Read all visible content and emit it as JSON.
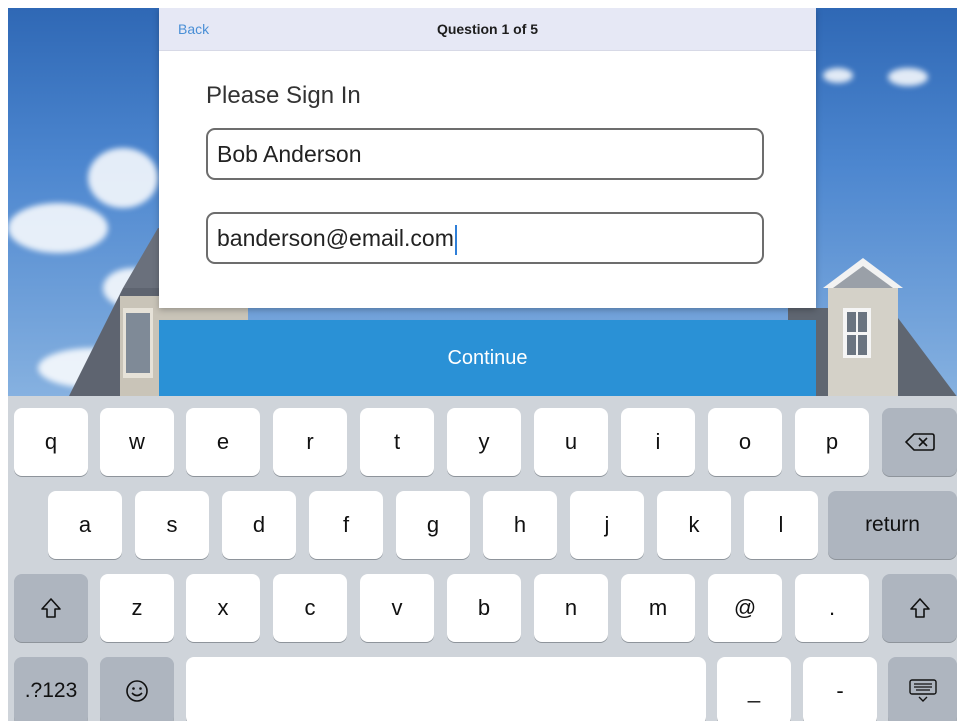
{
  "header": {
    "back_label": "Back",
    "title": "Question 1 of 5"
  },
  "form": {
    "prompt": "Please Sign In",
    "name_value": "Bob Anderson",
    "email_value": "banderson@email.com"
  },
  "continue_label": "Continue",
  "keyboard": {
    "row1": [
      "q",
      "w",
      "e",
      "r",
      "t",
      "y",
      "u",
      "i",
      "o",
      "p"
    ],
    "row2": [
      "a",
      "s",
      "d",
      "f",
      "g",
      "h",
      "j",
      "k",
      "l"
    ],
    "row3": [
      "z",
      "x",
      "c",
      "v",
      "b",
      "n",
      "m",
      "@",
      "."
    ],
    "return_label": "return",
    "numbers_label": ".?123",
    "underscore_label": "_",
    "dash_label": "-"
  },
  "colors": {
    "accent": "#2a91d6",
    "header_bg": "#e6e8f5",
    "link": "#4a8fd6"
  }
}
